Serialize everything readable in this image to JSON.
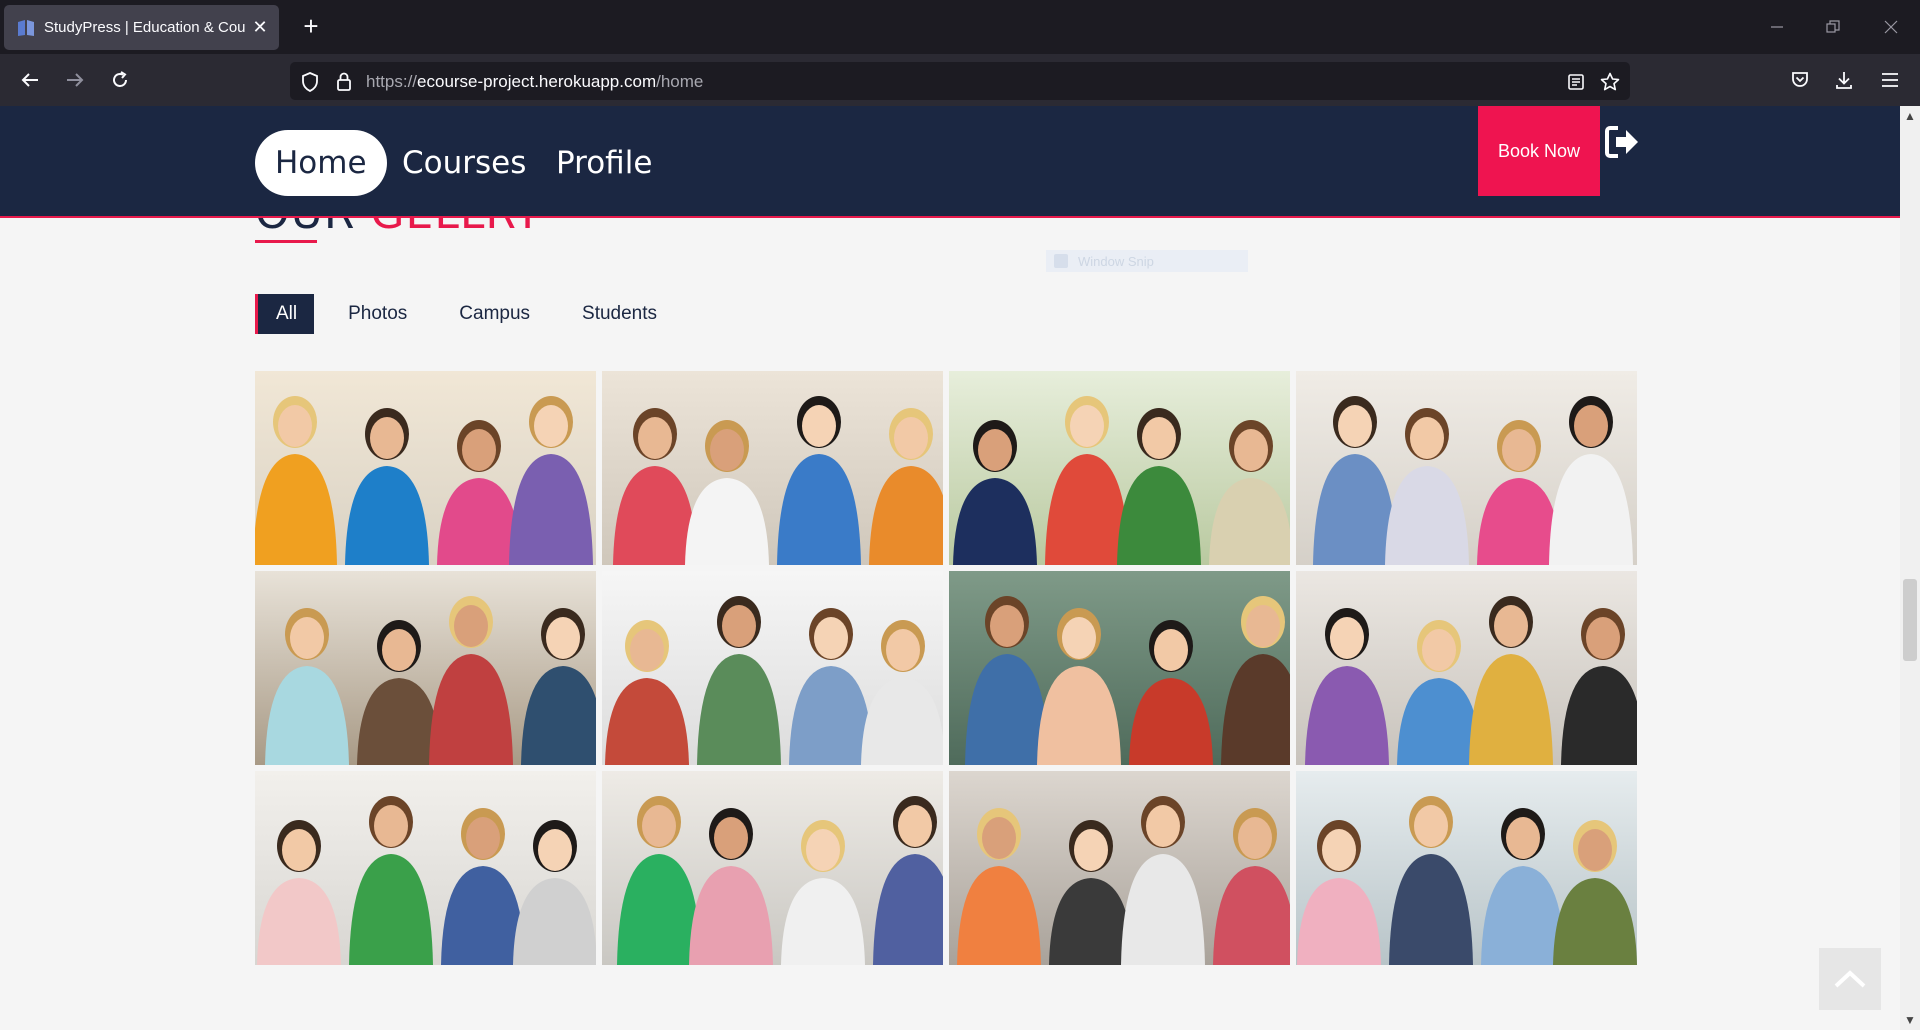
{
  "browser": {
    "tab_title": "StudyPress | Education & Course",
    "url_scheme": "https://",
    "url_host": "ecourse-project.herokuapp.com",
    "url_path": "/home"
  },
  "header": {
    "menu": [
      {
        "label": "Home",
        "active": true
      },
      {
        "label": "Courses",
        "active": false
      },
      {
        "label": "Profile",
        "active": false
      }
    ],
    "book_now_label": "Book Now"
  },
  "gallery_section": {
    "title_part1": "OUR",
    "title_part2": "GELLRY",
    "filters": [
      {
        "label": "All",
        "active": true
      },
      {
        "label": "Photos",
        "active": false
      },
      {
        "label": "Campus",
        "active": false
      },
      {
        "label": "Students",
        "active": false
      }
    ],
    "photos": [
      "students-walking-with-folders",
      "students-group-colorful-notebooks",
      "students-thumbs-up",
      "students-library-tablet",
      "student-library-bookshelf",
      "students-high-five",
      "students-chalkboard-group",
      "students-sitting-outdoors",
      "students-classroom-hand-raised",
      "students-exam-writing",
      "students-laptop-cafe",
      "students-walking-bicycle"
    ]
  },
  "overlay": {
    "label": "Window Snip"
  },
  "colors": {
    "navy": "#1b2742",
    "accent": "#e8194b",
    "book_now": "#ef1450"
  }
}
